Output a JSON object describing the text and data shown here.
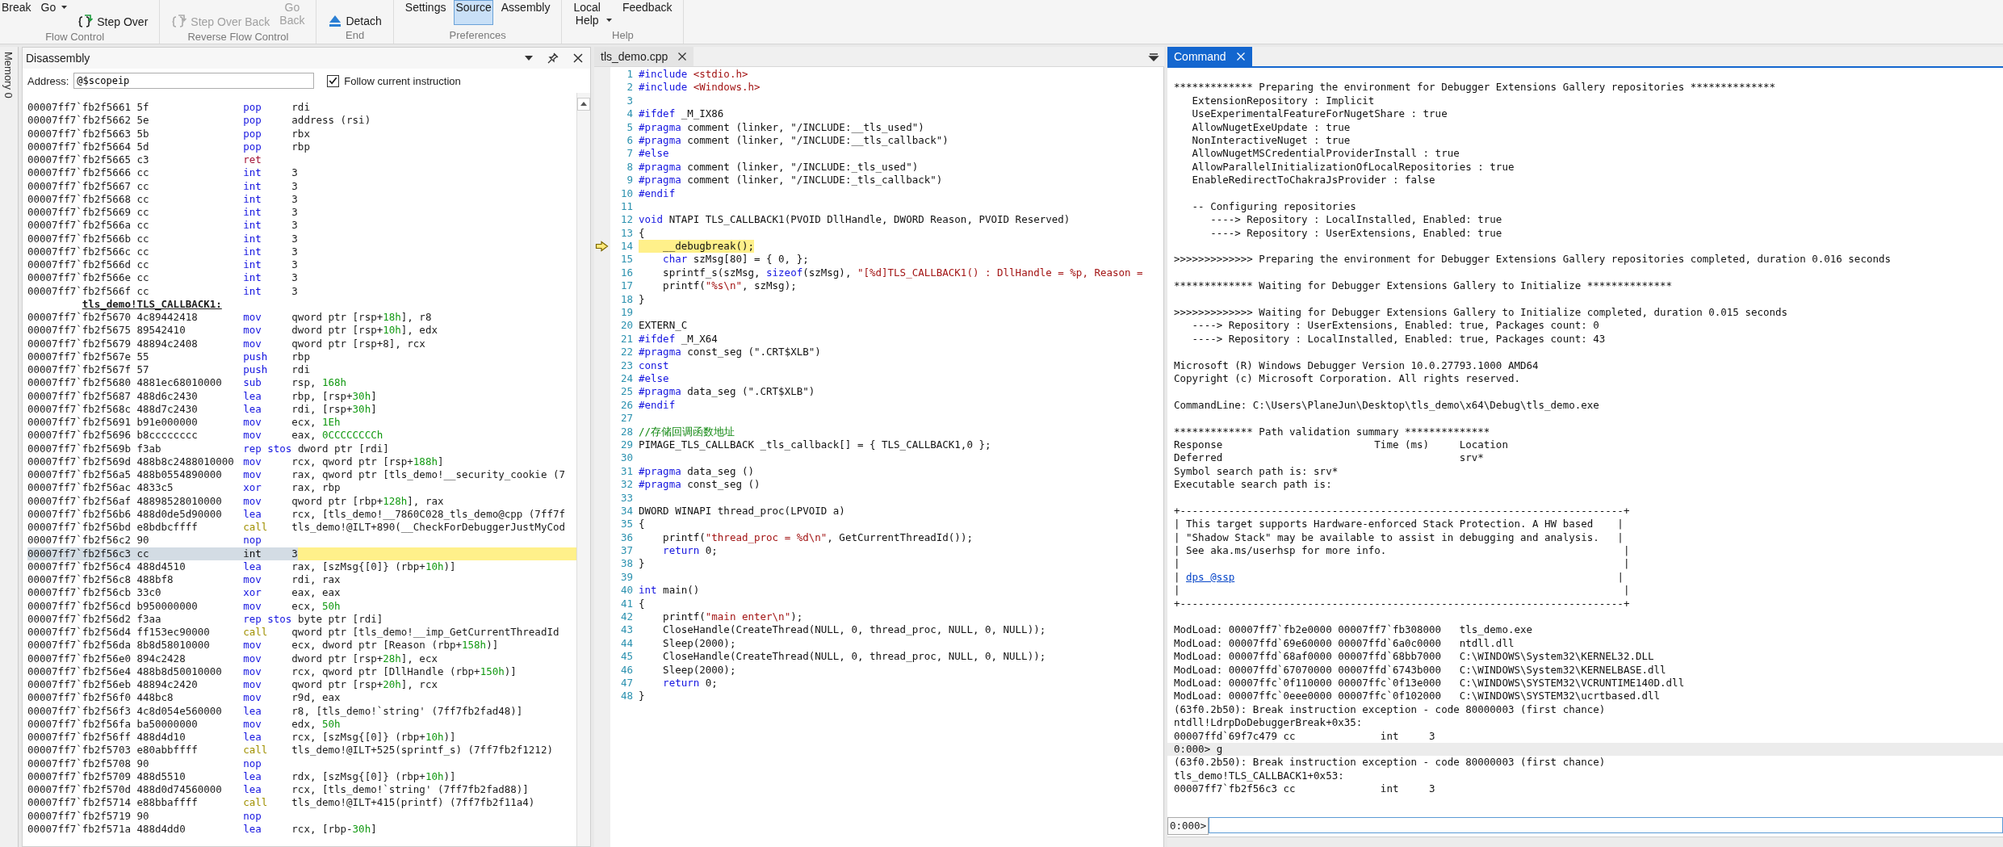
{
  "ribbon": {
    "groups": [
      {
        "label": "Flow Control",
        "items": [
          {
            "label": "Break",
            "kind": "text",
            "selected": false,
            "disabled": false
          },
          {
            "label": "Go",
            "kind": "dropdown",
            "selected": false,
            "disabled": false
          },
          {
            "label": "Step Over",
            "kind": "step",
            "selected": false,
            "disabled": false
          }
        ]
      },
      {
        "label": "Reverse Flow Control",
        "items": [
          {
            "label": "Step Over Back",
            "kind": "step",
            "selected": false,
            "disabled": true
          },
          {
            "label": "Go Back",
            "kind": "text",
            "selected": false,
            "disabled": true
          }
        ]
      },
      {
        "label": "End",
        "items": [
          {
            "label": "Detach",
            "kind": "eject",
            "selected": false,
            "disabled": false
          }
        ]
      },
      {
        "label": "Preferences",
        "items": [
          {
            "label": "Settings",
            "kind": "text",
            "selected": false,
            "disabled": false
          },
          {
            "label": "Source",
            "kind": "text",
            "selected": true,
            "disabled": false
          },
          {
            "label": "Assembly",
            "kind": "text",
            "selected": false,
            "disabled": false
          }
        ]
      },
      {
        "label": "Help",
        "items": [
          {
            "label": "Local Help",
            "kind": "dropdown",
            "selected": false,
            "disabled": false
          },
          {
            "label": "Feedback",
            "kind": "text",
            "selected": false,
            "disabled": false
          }
        ]
      }
    ]
  },
  "side_tab": {
    "label": "Memory 0"
  },
  "disassembly": {
    "title": "Disassembly",
    "address_label": "Address:",
    "address": "@$scopeip",
    "follow": {
      "label": "Follow current instruction",
      "checked": true
    },
    "rows": [
      {
        "kind": "op",
        "address": "00007ff7`fb2f5661",
        "bytes": "5f",
        "op": "pop",
        "operands": [
          "rdi"
        ],
        "current": false
      },
      {
        "kind": "op",
        "address": "00007ff7`fb2f5662",
        "bytes": "5e",
        "op": "pop",
        "operands": [
          "address (rsi)"
        ],
        "current": false
      },
      {
        "kind": "op",
        "address": "00007ff7`fb2f5663",
        "bytes": "5b",
        "op": "pop",
        "operands": [
          "rbx"
        ],
        "current": false
      },
      {
        "kind": "op",
        "address": "00007ff7`fb2f5664",
        "bytes": "5d",
        "op": "pop",
        "operands": [
          "rbp"
        ],
        "current": false
      },
      {
        "kind": "ret",
        "address": "00007ff7`fb2f5665",
        "bytes": "c3",
        "op": "ret",
        "current": false
      },
      {
        "kind": "op",
        "address": "00007ff7`fb2f5666",
        "bytes": "cc",
        "op": "int",
        "operands": [
          "3"
        ],
        "current": false
      },
      {
        "kind": "op",
        "address": "00007ff7`fb2f5667",
        "bytes": "cc",
        "op": "int",
        "operands": [
          "3"
        ],
        "current": false
      },
      {
        "kind": "op",
        "address": "00007ff7`fb2f5668",
        "bytes": "cc",
        "op": "int",
        "operands": [
          "3"
        ],
        "current": false
      },
      {
        "kind": "op",
        "address": "00007ff7`fb2f5669",
        "bytes": "cc",
        "op": "int",
        "operands": [
          "3"
        ],
        "current": false
      },
      {
        "kind": "op",
        "address": "00007ff7`fb2f566a",
        "bytes": "cc",
        "op": "int",
        "operands": [
          "3"
        ],
        "current": false
      },
      {
        "kind": "op",
        "address": "00007ff7`fb2f566b",
        "bytes": "cc",
        "op": "int",
        "operands": [
          "3"
        ],
        "current": false
      },
      {
        "kind": "op",
        "address": "00007ff7`fb2f566c",
        "bytes": "cc",
        "op": "int",
        "operands": [
          "3"
        ],
        "current": false
      },
      {
        "kind": "op",
        "address": "00007ff7`fb2f566d",
        "bytes": "cc",
        "op": "int",
        "operands": [
          "3"
        ],
        "current": false
      },
      {
        "kind": "op",
        "address": "00007ff7`fb2f566e",
        "bytes": "cc",
        "op": "int",
        "operands": [
          "3"
        ],
        "current": false
      },
      {
        "kind": "op",
        "address": "00007ff7`fb2f566f",
        "bytes": "cc",
        "op": "int",
        "operands": [
          "3"
        ],
        "current": false
      },
      {
        "kind": "label",
        "text": "tls_demo!TLS_CALLBACK1:"
      },
      {
        "kind": "op",
        "address": "00007ff7`fb2f5670",
        "bytes": "4c89442418",
        "op": "mov",
        "operands": [
          "qword ptr [rsp+",
          "18h",
          "], r8"
        ],
        "current": false
      },
      {
        "kind": "op",
        "address": "00007ff7`fb2f5675",
        "bytes": "89542410",
        "op": "mov",
        "operands": [
          "dword ptr [rsp+",
          "10h",
          "], edx"
        ],
        "current": false
      },
      {
        "kind": "op",
        "address": "00007ff7`fb2f5679",
        "bytes": "48894c2408",
        "op": "mov",
        "operands": [
          "qword ptr [rsp+8], rcx"
        ],
        "current": false
      },
      {
        "kind": "op",
        "address": "00007ff7`fb2f567e",
        "bytes": "55",
        "op": "push",
        "operands": [
          "rbp"
        ],
        "current": false
      },
      {
        "kind": "op",
        "address": "00007ff7`fb2f567f",
        "bytes": "57",
        "op": "push",
        "operands": [
          "rdi"
        ],
        "current": false
      },
      {
        "kind": "op",
        "address": "00007ff7`fb2f5680",
        "bytes": "4881ec68010000",
        "op": "sub",
        "operands": [
          "rsp, ",
          "168h"
        ],
        "current": false
      },
      {
        "kind": "op",
        "address": "00007ff7`fb2f5687",
        "bytes": "488d6c2430",
        "op": "lea",
        "operands": [
          "rbp, [rsp+",
          "30h",
          "]"
        ],
        "current": false
      },
      {
        "kind": "op",
        "address": "00007ff7`fb2f568c",
        "bytes": "488d7c2430",
        "op": "lea",
        "operands": [
          "rdi, [rsp+",
          "30h",
          "]"
        ],
        "current": false
      },
      {
        "kind": "op",
        "address": "00007ff7`fb2f5691",
        "bytes": "b91e000000",
        "op": "mov",
        "operands": [
          "ecx, ",
          "1Eh"
        ],
        "current": false
      },
      {
        "kind": "op",
        "address": "00007ff7`fb2f5696",
        "bytes": "b8cccccccc",
        "op": "mov",
        "operands": [
          "eax, ",
          "0CCCCCCCCh"
        ],
        "current": false
      },
      {
        "kind": "op",
        "address": "00007ff7`fb2f569b",
        "bytes": "f3ab",
        "op": "rep stos",
        "operands": [
          "dword ptr [rdi]"
        ],
        "current": false
      },
      {
        "kind": "op",
        "address": "00007ff7`fb2f569d",
        "bytes": "488b8c2488010000",
        "op": "mov",
        "operands": [
          "rcx, qword ptr [rsp+",
          "188h",
          "]"
        ],
        "current": false
      },
      {
        "kind": "op",
        "address": "00007ff7`fb2f56a5",
        "bytes": "488b0554890000",
        "op": "mov",
        "operands": [
          "rax, qword ptr [tls_demo!__security_cookie (7"
        ],
        "current": false
      },
      {
        "kind": "op",
        "address": "00007ff7`fb2f56ac",
        "bytes": "4833c5",
        "op": "xor",
        "operands": [
          "rax, rbp"
        ],
        "current": false
      },
      {
        "kind": "op",
        "address": "00007ff7`fb2f56af",
        "bytes": "48898528010000",
        "op": "mov",
        "operands": [
          "qword ptr [rbp+",
          "128h",
          "], rax"
        ],
        "current": false
      },
      {
        "kind": "op",
        "address": "00007ff7`fb2f56b6",
        "bytes": "488d0de5d90000",
        "op": "lea",
        "operands": [
          "rcx, [tls_demo!__7860C028_tls_demo@cpp (7ff7f"
        ],
        "current": false
      },
      {
        "kind": "call",
        "address": "00007ff7`fb2f56bd",
        "bytes": "e8bdbcffff",
        "op": "call",
        "operands": [
          "tls_demo!@ILT+890(__CheckForDebuggerJustMyCod"
        ],
        "current": false
      },
      {
        "kind": "op",
        "address": "00007ff7`fb2f56c2",
        "bytes": "90",
        "op": "nop",
        "current": false
      },
      {
        "kind": "op",
        "address": "00007ff7`fb2f56c3",
        "bytes": "cc",
        "op": "int",
        "operands": [
          "3"
        ],
        "current": true
      },
      {
        "kind": "op",
        "address": "00007ff7`fb2f56c4",
        "bytes": "488d4510",
        "op": "lea",
        "operands": [
          "rax, [szMsg{[0]} (rbp+",
          "10h",
          ")]"
        ],
        "current": false
      },
      {
        "kind": "op",
        "address": "00007ff7`fb2f56c8",
        "bytes": "488bf8",
        "op": "mov",
        "operands": [
          "rdi, rax"
        ],
        "current": false
      },
      {
        "kind": "op",
        "address": "00007ff7`fb2f56cb",
        "bytes": "33c0",
        "op": "xor",
        "operands": [
          "eax, eax"
        ],
        "current": false
      },
      {
        "kind": "op",
        "address": "00007ff7`fb2f56cd",
        "bytes": "b950000000",
        "op": "mov",
        "operands": [
          "ecx, ",
          "50h"
        ],
        "current": false
      },
      {
        "kind": "op",
        "address": "00007ff7`fb2f56d2",
        "bytes": "f3aa",
        "op": "rep stos",
        "operands": [
          "byte ptr [rdi]"
        ],
        "current": false
      },
      {
        "kind": "call",
        "address": "00007ff7`fb2f56d4",
        "bytes": "ff153ec90000",
        "op": "call",
        "operands": [
          "qword ptr [tls_demo!__imp_GetCurrentThreadId"
        ],
        "current": false
      },
      {
        "kind": "op",
        "address": "00007ff7`fb2f56da",
        "bytes": "8b8d58010000",
        "op": "mov",
        "operands": [
          "ecx, dword ptr [Reason (rbp+",
          "158h",
          ")]"
        ],
        "current": false
      },
      {
        "kind": "op",
        "address": "00007ff7`fb2f56e0",
        "bytes": "894c2428",
        "op": "mov",
        "operands": [
          "dword ptr [rsp+",
          "28h",
          "], ecx"
        ],
        "current": false
      },
      {
        "kind": "op",
        "address": "00007ff7`fb2f56e4",
        "bytes": "488b8d50010000",
        "op": "mov",
        "operands": [
          "rcx, qword ptr [DllHandle (rbp+",
          "150h",
          ")]"
        ],
        "current": false
      },
      {
        "kind": "op",
        "address": "00007ff7`fb2f56eb",
        "bytes": "48894c2420",
        "op": "mov",
        "operands": [
          "qword ptr [rsp+",
          "20h",
          "], rcx"
        ],
        "current": false
      },
      {
        "kind": "op",
        "address": "00007ff7`fb2f56f0",
        "bytes": "448bc8",
        "op": "mov",
        "operands": [
          "r9d, eax"
        ],
        "current": false
      },
      {
        "kind": "op",
        "address": "00007ff7`fb2f56f3",
        "bytes": "4c8d054e560000",
        "op": "lea",
        "operands": [
          "r8, [tls_demo!`string' (7ff7fb2fad48)]"
        ],
        "current": false
      },
      {
        "kind": "op",
        "address": "00007ff7`fb2f56fa",
        "bytes": "ba50000000",
        "op": "mov",
        "operands": [
          "edx, ",
          "50h"
        ],
        "current": false
      },
      {
        "kind": "op",
        "address": "00007ff7`fb2f56ff",
        "bytes": "488d4d10",
        "op": "lea",
        "operands": [
          "rcx, [szMsg{[0]} (rbp+",
          "10h",
          ")]"
        ],
        "current": false
      },
      {
        "kind": "call",
        "address": "00007ff7`fb2f5703",
        "bytes": "e80abbffff",
        "op": "call",
        "operands": [
          "tls_demo!@ILT+525(sprintf_s) (7ff7fb2f1212)"
        ],
        "current": false
      },
      {
        "kind": "op",
        "address": "00007ff7`fb2f5708",
        "bytes": "90",
        "op": "nop",
        "current": false
      },
      {
        "kind": "op",
        "address": "00007ff7`fb2f5709",
        "bytes": "488d5510",
        "op": "lea",
        "operands": [
          "rdx, [szMsg{[0]} (rbp+",
          "10h",
          ")]"
        ],
        "current": false
      },
      {
        "kind": "op",
        "address": "00007ff7`fb2f570d",
        "bytes": "488d0d74560000",
        "op": "lea",
        "operands": [
          "rcx, [tls_demo!`string' (7ff7fb2fad88)]"
        ],
        "current": false
      },
      {
        "kind": "call",
        "address": "00007ff7`fb2f5714",
        "bytes": "e88bbaffff",
        "op": "call",
        "operands": [
          "tls_demo!@ILT+415(printf) (7ff7fb2f11a4)"
        ],
        "current": false
      },
      {
        "kind": "op",
        "address": "00007ff7`fb2f5719",
        "bytes": "90",
        "op": "nop",
        "current": false
      },
      {
        "kind": "op",
        "address": "00007ff7`fb2f571a",
        "bytes": "488d4dd0",
        "op": "lea",
        "operands": [
          "rcx, [rbp-",
          "30h",
          "]"
        ],
        "current": false
      }
    ]
  },
  "editor": {
    "tab": "tls_demo.cpp",
    "lines": [
      {
        "no": "1",
        "current": false,
        "segs": [
          {
            "text": "#include ",
            "kind": "kw"
          },
          {
            "text": "<stdio.h>",
            "kind": "str"
          }
        ]
      },
      {
        "no": "2",
        "current": false,
        "segs": [
          {
            "text": "#include ",
            "kind": "kw"
          },
          {
            "text": "<Windows.h>",
            "kind": "str"
          }
        ]
      },
      {
        "no": "3",
        "current": false
      },
      {
        "no": "4",
        "current": false,
        "segs": [
          {
            "text": "#ifdef ",
            "kind": "kw"
          },
          {
            "text": "_M_IX86",
            "kind": "plain"
          }
        ]
      },
      {
        "no": "5",
        "current": false,
        "segs": [
          {
            "text": "#pragma ",
            "kind": "kw"
          },
          {
            "text": "comment (linker, \"/INCLUDE:__tls_used\")",
            "kind": "plain"
          }
        ]
      },
      {
        "no": "6",
        "current": false,
        "segs": [
          {
            "text": "#pragma ",
            "kind": "kw"
          },
          {
            "text": "comment (linker, \"/INCLUDE:__tls_callback\")",
            "kind": "plain"
          }
        ]
      },
      {
        "no": "7",
        "current": false,
        "segs": [
          {
            "text": "#else",
            "kind": "kw"
          }
        ]
      },
      {
        "no": "8",
        "current": false,
        "segs": [
          {
            "text": "#pragma ",
            "kind": "kw"
          },
          {
            "text": "comment (linker, \"/INCLUDE:_tls_used\")",
            "kind": "plain"
          }
        ]
      },
      {
        "no": "9",
        "current": false,
        "segs": [
          {
            "text": "#pragma ",
            "kind": "kw"
          },
          {
            "text": "comment (linker, \"/INCLUDE:_tls_callback\")",
            "kind": "plain"
          }
        ]
      },
      {
        "no": "10",
        "current": false,
        "segs": [
          {
            "text": "#endif",
            "kind": "kw"
          }
        ]
      },
      {
        "no": "11",
        "current": false
      },
      {
        "no": "12",
        "current": false,
        "segs": [
          {
            "text": "void ",
            "kind": "kw"
          },
          {
            "text": "NTAPI TLS_CALLBACK1(PVOID DllHandle, DWORD Reason, PVOID Reserved)",
            "kind": "plain"
          }
        ]
      },
      {
        "no": "13",
        "current": false,
        "segs": [
          {
            "text": "{",
            "kind": "plain"
          }
        ]
      },
      {
        "no": "14",
        "current": true,
        "segs": [
          {
            "text": "    __debugbreak();",
            "kind": "plain"
          }
        ]
      },
      {
        "no": "15",
        "current": false,
        "segs": [
          {
            "text": "    char ",
            "kind": "kw"
          },
          {
            "text": "szMsg[80] = { 0, };",
            "kind": "plain"
          }
        ]
      },
      {
        "no": "16",
        "current": false,
        "segs": [
          {
            "text": "    sprintf_s(szMsg, ",
            "kind": "plain"
          },
          {
            "text": "sizeof",
            "kind": "kw"
          },
          {
            "text": "(szMsg), ",
            "kind": "plain"
          },
          {
            "text": "\"[%d]TLS_CALLBACK1() : DllHandle = %p, Reason = ",
            "kind": "str"
          }
        ]
      },
      {
        "no": "17",
        "current": false,
        "segs": [
          {
            "text": "    printf(",
            "kind": "plain"
          },
          {
            "text": "\"%s\\n\"",
            "kind": "str"
          },
          {
            "text": ", szMsg);",
            "kind": "plain"
          }
        ]
      },
      {
        "no": "18",
        "current": false,
        "segs": [
          {
            "text": "}",
            "kind": "plain"
          }
        ]
      },
      {
        "no": "19",
        "current": false
      },
      {
        "no": "20",
        "current": false,
        "segs": [
          {
            "text": "EXTERN_C",
            "kind": "plain"
          }
        ]
      },
      {
        "no": "21",
        "current": false,
        "segs": [
          {
            "text": "#ifdef ",
            "kind": "kw"
          },
          {
            "text": "_M_X64",
            "kind": "plain"
          }
        ]
      },
      {
        "no": "22",
        "current": false,
        "segs": [
          {
            "text": "#pragma ",
            "kind": "kw"
          },
          {
            "text": "const_seg (\".CRT$XLB\")",
            "kind": "plain"
          }
        ]
      },
      {
        "no": "23",
        "current": false,
        "segs": [
          {
            "text": "const",
            "kind": "kw"
          }
        ]
      },
      {
        "no": "24",
        "current": false,
        "segs": [
          {
            "text": "#else",
            "kind": "kw"
          }
        ]
      },
      {
        "no": "25",
        "current": false,
        "segs": [
          {
            "text": "#pragma ",
            "kind": "kw"
          },
          {
            "text": "data_seg (\".CRT$XLB\")",
            "kind": "plain"
          }
        ]
      },
      {
        "no": "26",
        "current": false,
        "segs": [
          {
            "text": "#endif",
            "kind": "kw"
          }
        ]
      },
      {
        "no": "27",
        "current": false
      },
      {
        "no": "28",
        "current": false,
        "segs": [
          {
            "text": "//存储回调函数地址",
            "kind": "com"
          }
        ]
      },
      {
        "no": "29",
        "current": false,
        "segs": [
          {
            "text": "PIMAGE_TLS_CALLBACK _tls_callback[] = { TLS_CALLBACK1,0 };",
            "kind": "plain"
          }
        ]
      },
      {
        "no": "30",
        "current": false
      },
      {
        "no": "31",
        "current": false,
        "segs": [
          {
            "text": "#pragma ",
            "kind": "kw"
          },
          {
            "text": "data_seg ()",
            "kind": "plain"
          }
        ]
      },
      {
        "no": "32",
        "current": false,
        "segs": [
          {
            "text": "#pragma ",
            "kind": "kw"
          },
          {
            "text": "const_seg ()",
            "kind": "plain"
          }
        ]
      },
      {
        "no": "33",
        "current": false
      },
      {
        "no": "34",
        "current": false,
        "segs": [
          {
            "text": "DWORD WINAPI thread_proc(LPVOID a)",
            "kind": "plain"
          }
        ]
      },
      {
        "no": "35",
        "current": false,
        "segs": [
          {
            "text": "{",
            "kind": "plain"
          }
        ]
      },
      {
        "no": "36",
        "current": false,
        "segs": [
          {
            "text": "    printf(",
            "kind": "plain"
          },
          {
            "text": "\"thread_proc = %d\\n\"",
            "kind": "str"
          },
          {
            "text": ", GetCurrentThreadId());",
            "kind": "plain"
          }
        ]
      },
      {
        "no": "37",
        "current": false,
        "segs": [
          {
            "text": "    return ",
            "kind": "kw"
          },
          {
            "text": "0;",
            "kind": "plain"
          }
        ]
      },
      {
        "no": "38",
        "current": false,
        "segs": [
          {
            "text": "}",
            "kind": "plain"
          }
        ]
      },
      {
        "no": "39",
        "current": false
      },
      {
        "no": "40",
        "current": false,
        "segs": [
          {
            "text": "int ",
            "kind": "kw"
          },
          {
            "text": "main()",
            "kind": "plain"
          }
        ]
      },
      {
        "no": "41",
        "current": false,
        "segs": [
          {
            "text": "{",
            "kind": "plain"
          }
        ]
      },
      {
        "no": "42",
        "current": false,
        "segs": [
          {
            "text": "    printf(",
            "kind": "plain"
          },
          {
            "text": "\"main enter\\n\"",
            "kind": "str"
          },
          {
            "text": ");",
            "kind": "plain"
          }
        ]
      },
      {
        "no": "43",
        "current": false,
        "segs": [
          {
            "text": "    CloseHandle(CreateThread(NULL, 0, thread_proc, NULL, 0, NULL));",
            "kind": "plain"
          }
        ]
      },
      {
        "no": "44",
        "current": false,
        "segs": [
          {
            "text": "    Sleep(2000);",
            "kind": "plain"
          }
        ]
      },
      {
        "no": "45",
        "current": false,
        "segs": [
          {
            "text": "    CloseHandle(CreateThread(NULL, 0, thread_proc, NULL, 0, NULL));",
            "kind": "plain"
          }
        ]
      },
      {
        "no": "46",
        "current": false,
        "segs": [
          {
            "text": "    Sleep(2000);",
            "kind": "plain"
          }
        ]
      },
      {
        "no": "47",
        "current": false,
        "segs": [
          {
            "text": "    return ",
            "kind": "kw"
          },
          {
            "text": "0;",
            "kind": "plain"
          }
        ]
      },
      {
        "no": "48",
        "current": false,
        "segs": [
          {
            "text": "}",
            "kind": "plain"
          }
        ]
      }
    ]
  },
  "command": {
    "tab": "Command",
    "lines": [
      {
        "kind": "blank"
      },
      {
        "kind": "text",
        "text": "************* Preparing the environment for Debugger Extensions Gallery repositories **************"
      },
      {
        "kind": "text",
        "text": "   ExtensionRepository : Implicit"
      },
      {
        "kind": "text",
        "text": "   UseExperimentalFeatureForNugetShare : true"
      },
      {
        "kind": "text",
        "text": "   AllowNugetExeUpdate : true"
      },
      {
        "kind": "text",
        "text": "   NonInteractiveNuget : true"
      },
      {
        "kind": "text",
        "text": "   AllowNugetMSCredentialProviderInstall : true"
      },
      {
        "kind": "text",
        "text": "   AllowParallelInitializationOfLocalRepositories : true"
      },
      {
        "kind": "text",
        "text": "   EnableRedirectToChakraJsProvider : false"
      },
      {
        "kind": "blank"
      },
      {
        "kind": "text",
        "text": "   -- Configuring repositories"
      },
      {
        "kind": "text",
        "text": "      ----> Repository : LocalInstalled, Enabled: true"
      },
      {
        "kind": "text",
        "text": "      ----> Repository : UserExtensions, Enabled: true"
      },
      {
        "kind": "blank"
      },
      {
        "kind": "text",
        "text": ">>>>>>>>>>>>> Preparing the environment for Debugger Extensions Gallery repositories completed, duration 0.016 seconds"
      },
      {
        "kind": "blank"
      },
      {
        "kind": "text",
        "text": "************* Waiting for Debugger Extensions Gallery to Initialize **************"
      },
      {
        "kind": "blank"
      },
      {
        "kind": "text",
        "text": ">>>>>>>>>>>>> Waiting for Debugger Extensions Gallery to Initialize completed, duration 0.015 seconds"
      },
      {
        "kind": "text",
        "text": "   ----> Repository : UserExtensions, Enabled: true, Packages count: 0"
      },
      {
        "kind": "text",
        "text": "   ----> Repository : LocalInstalled, Enabled: true, Packages count: 43"
      },
      {
        "kind": "blank"
      },
      {
        "kind": "text",
        "text": "Microsoft (R) Windows Debugger Version 10.0.27793.1000 AMD64"
      },
      {
        "kind": "text",
        "text": "Copyright (c) Microsoft Corporation. All rights reserved."
      },
      {
        "kind": "blank"
      },
      {
        "kind": "text",
        "text": "CommandLine: C:\\Users\\PlaneJun\\Desktop\\tls_demo\\x64\\Debug\\tls_demo.exe"
      },
      {
        "kind": "blank"
      },
      {
        "kind": "text",
        "text": "************* Path validation summary **************"
      },
      {
        "kind": "text",
        "text": "Response                         Time (ms)     Location"
      },
      {
        "kind": "text",
        "text": "Deferred                                       srv*"
      },
      {
        "kind": "text",
        "text": "Symbol search path is: srv*"
      },
      {
        "kind": "text",
        "text": "Executable search path is:"
      },
      {
        "kind": "blank"
      },
      {
        "kind": "text",
        "text": "+-------------------------------------------------------------------------+"
      },
      {
        "kind": "text",
        "text": "| This target supports Hardware-enforced Stack Protection. A HW based    |"
      },
      {
        "kind": "text",
        "text": "| \"Shadow Stack\" may be available to assist in debugging and analysis.   |"
      },
      {
        "kind": "text",
        "text": "| See aka.ms/userhsp for more info.                                       |"
      },
      {
        "kind": "text",
        "text": "|                                                                         |"
      },
      {
        "kind": "link",
        "before": "| ",
        "link": "dps @ssp",
        "after": "                                                               |"
      },
      {
        "kind": "text",
        "text": "|                                                                         |"
      },
      {
        "kind": "text",
        "text": "+-------------------------------------------------------------------------+"
      },
      {
        "kind": "blank"
      },
      {
        "kind": "text",
        "text": "ModLoad: 00007ff7`fb2e0000 00007ff7`fb308000   tls_demo.exe"
      },
      {
        "kind": "text",
        "text": "ModLoad: 00007ffd`69e60000 00007ffd`6a0c0000   ntdll.dll"
      },
      {
        "kind": "text",
        "text": "ModLoad: 00007ffd`68af0000 00007ffd`68bb7000   C:\\WINDOWS\\System32\\KERNEL32.DLL"
      },
      {
        "kind": "text",
        "text": "ModLoad: 00007ffd`67070000 00007ffd`6743b000   C:\\WINDOWS\\System32\\KERNELBASE.dll"
      },
      {
        "kind": "text",
        "text": "ModLoad: 00007ffc`0f110000 00007ffc`0f13e000   C:\\WINDOWS\\SYSTEM32\\VCRUNTIME140D.dll"
      },
      {
        "kind": "text",
        "text": "ModLoad: 00007ffc`0eee0000 00007ffc`0f102000   C:\\WINDOWS\\SYSTEM32\\ucrtbased.dll"
      },
      {
        "kind": "text",
        "text": "(63f0.2b50): Break instruction exception - code 80000003 (first chance)"
      },
      {
        "kind": "text",
        "text": "ntdll!LdrpDoDebuggerBreak+0x35:"
      },
      {
        "kind": "text",
        "text": "00007ffd`69f7c479 cc              int     3"
      },
      {
        "kind": "echo",
        "text": "0:000> g"
      },
      {
        "kind": "text",
        "text": "(63f0.2b50): Break instruction exception - code 80000003 (first chance)"
      },
      {
        "kind": "text",
        "text": "tls_demo!TLS_CALLBACK1+0x53:"
      },
      {
        "kind": "text",
        "text": "00007ff7`fb2f56c3 cc              int     3"
      }
    ],
    "prompt": "0:000>"
  }
}
